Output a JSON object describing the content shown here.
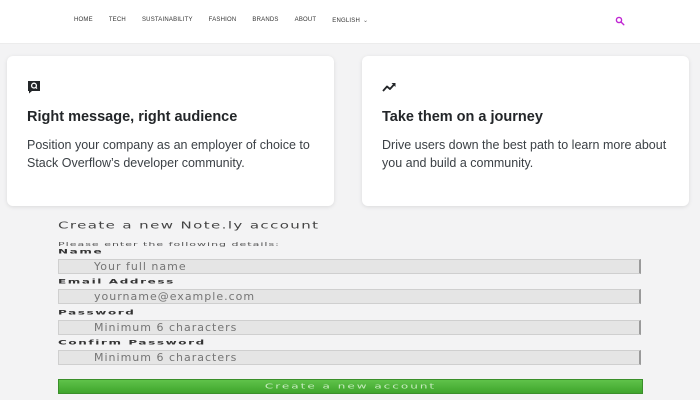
{
  "nav": {
    "items": [
      {
        "label": "Home"
      },
      {
        "label": "Tech"
      },
      {
        "label": "Sustainability"
      },
      {
        "label": "Fashion"
      },
      {
        "label": "Brands"
      },
      {
        "label": "About"
      },
      {
        "label": "English"
      }
    ],
    "search_icon": "search-icon",
    "accent": "#c026d3"
  },
  "cards": [
    {
      "icon": "chat-question-icon",
      "title": "Right message, right audience",
      "text": "Position your company as an employer of choice to Stack Overflow’s developer community."
    },
    {
      "icon": "trend-up-icon",
      "title": "Take them on a journey",
      "text": "Drive users down the best path to learn more about you and build a community."
    }
  ],
  "form": {
    "heading": "Create a new Note.ly account",
    "subheading": "Please enter the following details:",
    "fields": [
      {
        "label": "Name",
        "placeholder": "Your full name"
      },
      {
        "label": "Email Address",
        "placeholder": "yourname@example.com"
      },
      {
        "label": "Password",
        "placeholder": "Minimum 6 characters"
      },
      {
        "label": "Confirm Password",
        "placeholder": "Minimum 6 characters"
      }
    ],
    "submit_label": "Create a new account",
    "submit_color": "#4cae37"
  }
}
